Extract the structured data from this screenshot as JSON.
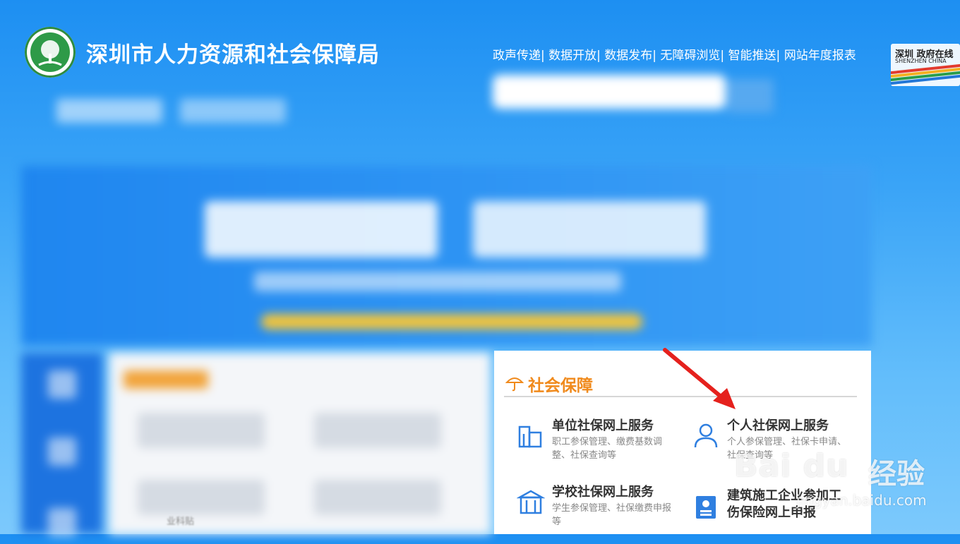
{
  "header": {
    "title": "深圳市人力资源和社会保障局",
    "links": [
      "政声传递|",
      "数据开放|",
      "数据发布|",
      "无障碍浏览|",
      "智能推送|",
      "网站年度报表"
    ],
    "gov_logo": {
      "line1": "深圳 政府在线",
      "line2": "SHENZHEN CHINA"
    }
  },
  "panel": {
    "title": "社会保障",
    "services": [
      {
        "title": "单位社保网上服务",
        "desc": "职工参保管理、缴费基数调整、社保查询等",
        "icon": "building-chart-icon"
      },
      {
        "title": "个人社保网上服务",
        "desc": "个人参保管理、社保卡申请、社保查询等",
        "icon": "person-icon"
      },
      {
        "title": "学校社保网上服务",
        "desc": "学生参保管理、社保缴费申报等",
        "icon": "school-icon"
      },
      {
        "title": "建筑施工企业参加工伤保险网上申报",
        "desc": "",
        "icon": "id-card-icon"
      }
    ]
  },
  "blurred": {
    "footer_text": "业科贴"
  },
  "watermark": {
    "brand": "Bai du",
    "name": "经验",
    "url": "jingyan.baidu.com"
  },
  "colors": {
    "accent": "#f08a1c",
    "primary": "#1d8ff2",
    "arrow": "#e5211d"
  }
}
